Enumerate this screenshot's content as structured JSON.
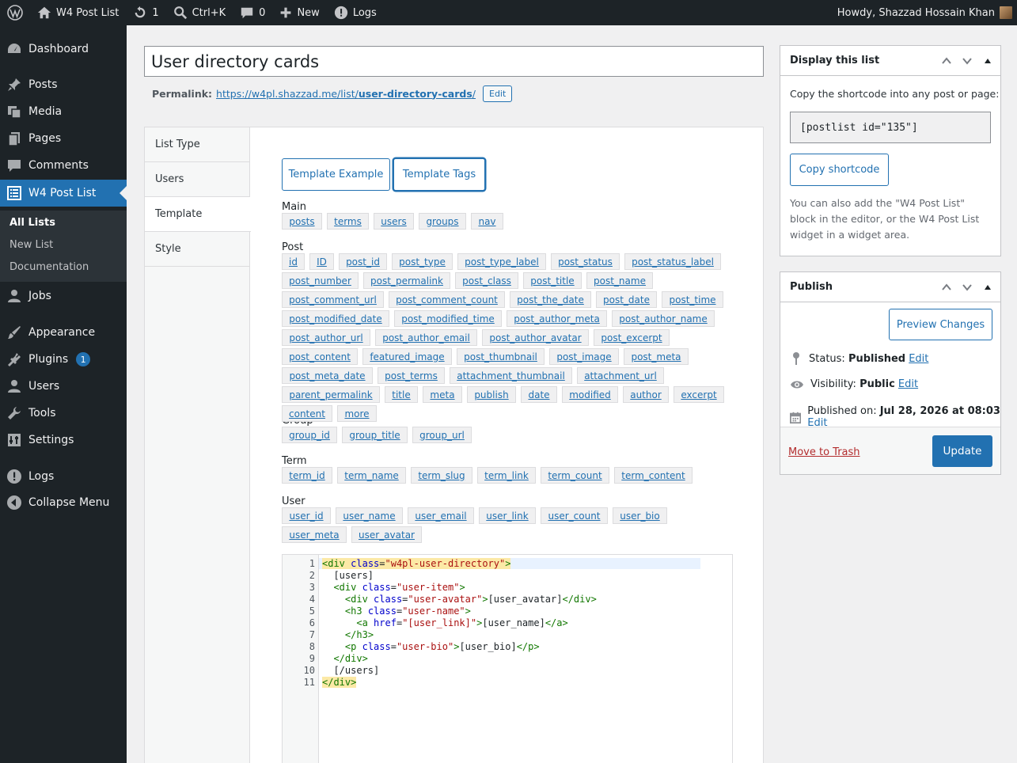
{
  "adminbar": {
    "site_name": "W4 Post List",
    "updates_count": "1",
    "search_shortcut": "Ctrl+K",
    "comments_count": "0",
    "new_label": "New",
    "logs_label": "Logs",
    "howdy": "Howdy, Shazzad Hossain Khan"
  },
  "sidebar": {
    "dashboard": "Dashboard",
    "posts": "Posts",
    "media": "Media",
    "pages": "Pages",
    "comments": "Comments",
    "w4postlist": "W4 Post List",
    "sub_all": "All Lists",
    "sub_new": "New List",
    "sub_docs": "Documentation",
    "jobs": "Jobs",
    "appearance": "Appearance",
    "plugins": "Plugins",
    "plugins_badge": "1",
    "users": "Users",
    "tools": "Tools",
    "settings": "Settings",
    "logs": "Logs",
    "collapse": "Collapse Menu"
  },
  "post": {
    "title": "User directory cards",
    "permalink_label": "Permalink:",
    "permalink_base": "https://w4pl.shazzad.me/list/",
    "permalink_slug": "user-directory-cards",
    "permalink_end": "/",
    "edit_label": "Edit"
  },
  "tabs": [
    "List Type",
    "Users",
    "Template",
    "Style"
  ],
  "template": {
    "example_btn": "Template Example",
    "tags_btn": "Template Tags",
    "groups": {
      "main": "Main",
      "post": "Post",
      "group": "Group",
      "term": "Term",
      "user": "User"
    },
    "tags_main": [
      "posts",
      "terms",
      "users",
      "groups",
      "nav"
    ],
    "tags_post": [
      "id",
      "ID",
      "post_id",
      "post_type",
      "post_type_label",
      "post_status",
      "post_status_label",
      "post_number",
      "post_permalink",
      "post_class",
      "post_title",
      "post_name",
      "post_comment_url",
      "post_comment_count",
      "post_the_date",
      "post_date",
      "post_time",
      "post_modified_date",
      "post_modified_time",
      "post_author_meta",
      "post_author_name",
      "post_author_url",
      "post_author_email",
      "post_author_avatar",
      "post_excerpt",
      "post_content",
      "featured_image",
      "post_thumbnail",
      "post_image",
      "post_meta",
      "post_meta_date",
      "post_terms",
      "attachment_thumbnail",
      "attachment_url",
      "parent_permalink",
      "title",
      "meta",
      "publish",
      "date",
      "modified",
      "author",
      "excerpt",
      "content",
      "more"
    ],
    "tags_group": [
      "group_id",
      "group_title",
      "group_url"
    ],
    "tags_term": [
      "term_id",
      "term_name",
      "term_slug",
      "term_link",
      "term_count",
      "term_content"
    ],
    "tags_user": [
      "user_id",
      "user_name",
      "user_email",
      "user_link",
      "user_count",
      "user_bio",
      "user_meta",
      "user_avatar"
    ]
  },
  "code_lines": [
    "<div class=\"w4pl-user-directory\">",
    "  [users]",
    "  <div class=\"user-item\">",
    "    <div class=\"user-avatar\">[user_avatar]</div>",
    "    <h3 class=\"user-name\">",
    "      <a href=\"[user_link]\">[user_name]</a>",
    "    </h3>",
    "    <p class=\"user-bio\">[user_bio]</p>",
    "  </div>",
    "  [/users]",
    "</div>"
  ],
  "display_box": {
    "title": "Display this list",
    "intro": "Copy the shortcode into any post or page:",
    "shortcode": "[postlist id=\"135\"]",
    "copy_btn": "Copy shortcode",
    "note": "You can also add the \"W4 Post List\" block in the editor, or the W4 Post List widget in a widget area."
  },
  "publish_box": {
    "title": "Publish",
    "preview_btn": "Preview Changes",
    "status_label": "Status:",
    "status_value": "Published",
    "visibility_label": "Visibility:",
    "visibility_value": "Public",
    "published_label": "Published on:",
    "published_value": "Jul 28, 2026 at 08:03",
    "edit_label": "Edit",
    "trash_label": "Move to Trash",
    "update_btn": "Update"
  },
  "colors": {
    "accent": "#2271b1",
    "sidebar_bg": "#1d2327",
    "trash": "#b32d2e"
  }
}
